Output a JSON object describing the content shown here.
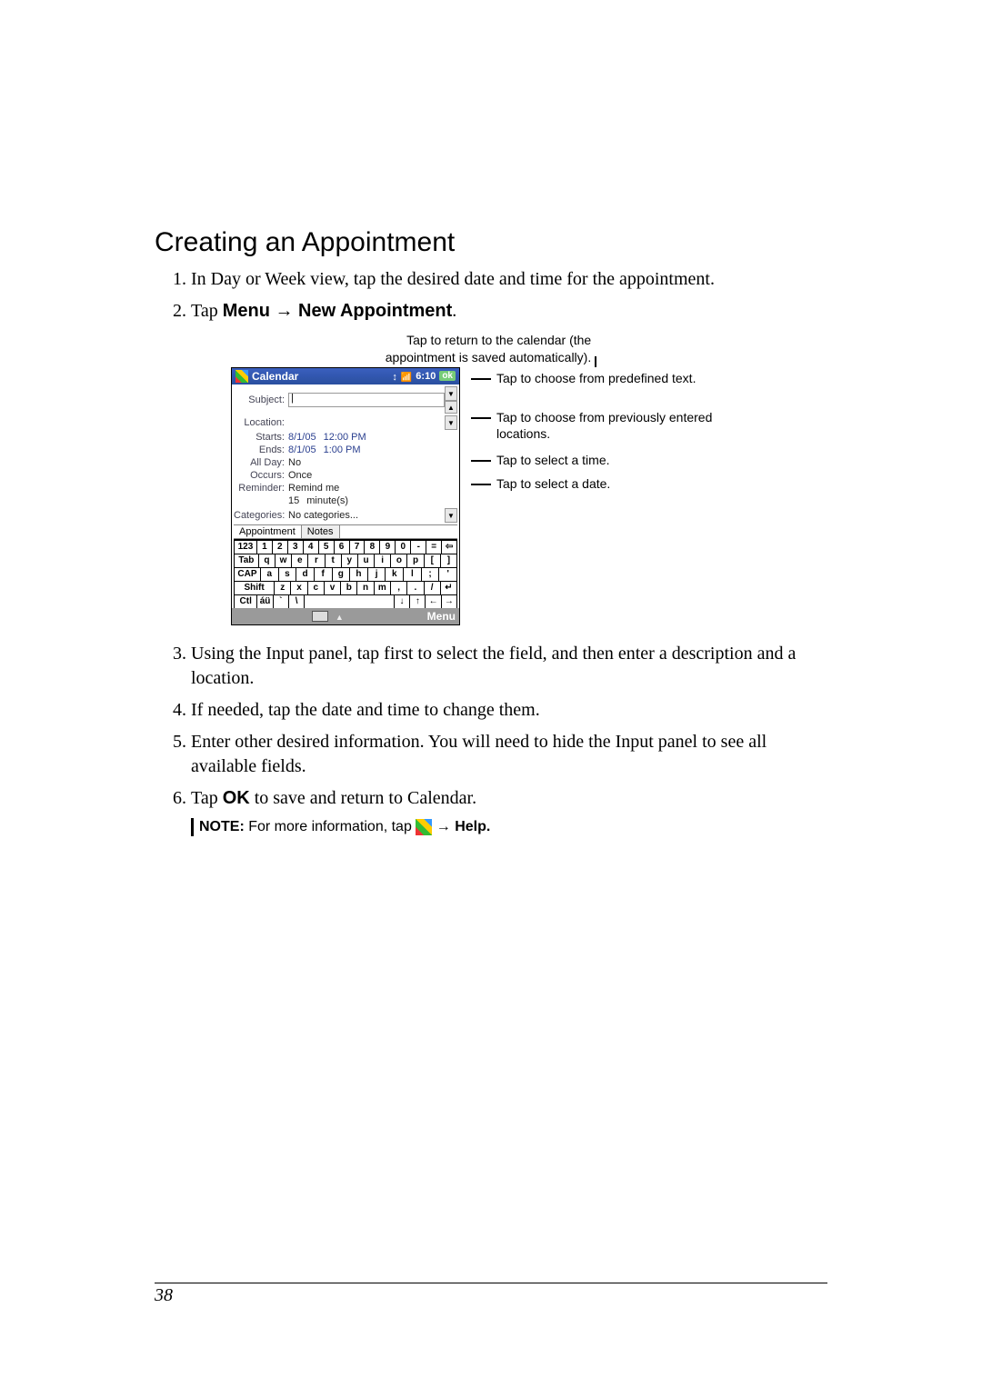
{
  "heading": "Creating an Appointment",
  "steps": {
    "s1": "In Day or Week view, tap the desired date and time for the appointment.",
    "s2_pre": "Tap ",
    "s2_menu": "Menu",
    "s2_arrow": " → ",
    "s2_newappt": "New Appointment",
    "s2_dot": ".",
    "s3": "Using the Input panel, tap first to select the field, and then enter a description and a location.",
    "s4": "If needed, tap the date and time to change them.",
    "s5": "Enter other desired information. You will need to hide the Input panel to see all available fields.",
    "s6_pre": "Tap ",
    "s6_ok": "OK",
    "s6_post": " to save and return to Calendar."
  },
  "caption_top_l1": "Tap to return to the calendar (the",
  "caption_top_l2": "appointment is saved automatically).",
  "annotations": {
    "a1": "Tap to choose from predefined text.",
    "a2": "Tap to choose from previously entered locations.",
    "a3": "Tap to select a time.",
    "a4": "Tap to select a date."
  },
  "device": {
    "title": "Calendar",
    "time": "6:10",
    "ok": "ok",
    "labels": {
      "subject": "Subject:",
      "location": "Location:",
      "starts": "Starts:",
      "ends": "Ends:",
      "allday": "All Day:",
      "occurs": "Occurs:",
      "reminder": "Reminder:",
      "categories": "Categories:"
    },
    "values": {
      "starts_date": "8/1/05",
      "starts_time": "12:00 PM",
      "ends_date": "8/1/05",
      "ends_time": "1:00 PM",
      "allday": "No",
      "occurs": "Once",
      "reminder": "Remind me",
      "reminder_qty": "15",
      "reminder_unit": "minute(s)",
      "categories": "No categories..."
    },
    "tabs": {
      "appointment": "Appointment",
      "notes": "Notes"
    },
    "keyboard": {
      "row1": [
        "123",
        "1",
        "2",
        "3",
        "4",
        "5",
        "6",
        "7",
        "8",
        "9",
        "0",
        "-",
        "="
      ],
      "row2": [
        "Tab",
        "q",
        "w",
        "e",
        "r",
        "t",
        "y",
        "u",
        "i",
        "o",
        "p",
        "[",
        "]"
      ],
      "row3": [
        "CAP",
        "a",
        "s",
        "d",
        "f",
        "g",
        "h",
        "j",
        "k",
        "l",
        ";",
        "'"
      ],
      "row4": [
        "Shift",
        "z",
        "x",
        "c",
        "v",
        "b",
        "n",
        "m",
        ",",
        ".",
        "/"
      ],
      "row5": [
        "Ctl",
        "áü",
        "`",
        "\\"
      ]
    },
    "menu": "Menu"
  },
  "note": {
    "label": "NOTE:",
    "text": " For more information, tap ",
    "arrow": " → ",
    "help": "Help."
  },
  "page_number": "38"
}
